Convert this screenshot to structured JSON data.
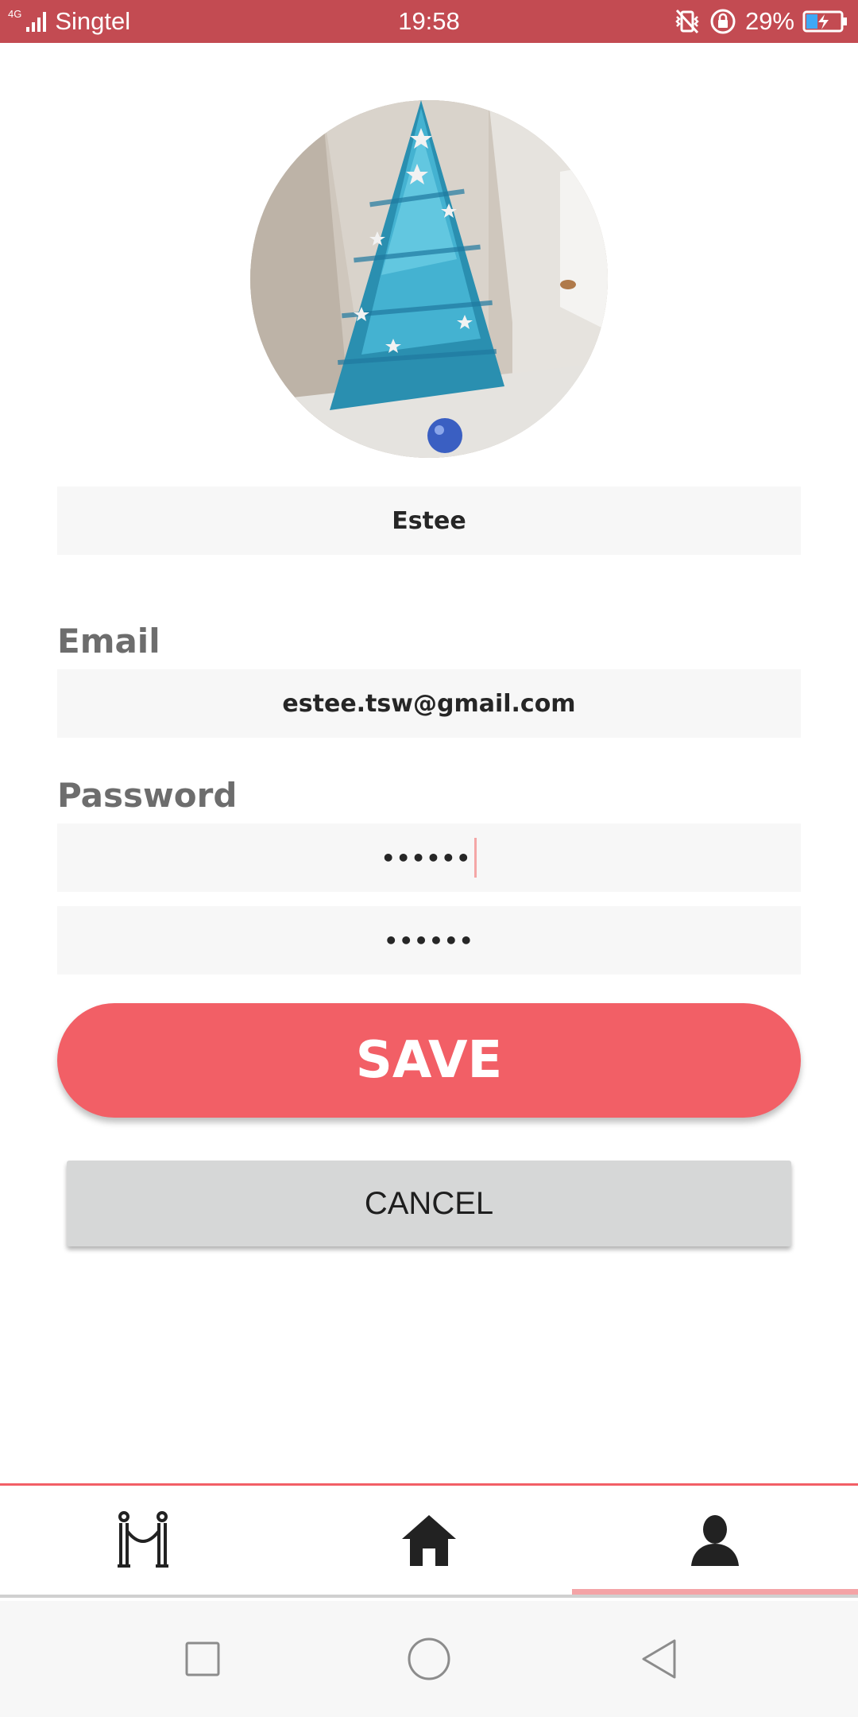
{
  "status_bar": {
    "network_type": "4G",
    "carrier": "Singtel",
    "time": "19:58",
    "battery_percent": "29%",
    "icons": [
      "signal-icon",
      "vibrate-icon",
      "rotation-lock-icon",
      "battery-charging-icon"
    ]
  },
  "profile": {
    "avatar": "christmas-tree-photo",
    "name_value": "Estee"
  },
  "email": {
    "label": "Email",
    "value": "estee.tsw@gmail.com"
  },
  "password": {
    "label": "Password",
    "value": "••••••",
    "confirm_value": "••••••"
  },
  "actions": {
    "save_label": "SAVE",
    "cancel_label": "CANCEL"
  },
  "bottom_nav": {
    "items": [
      {
        "icon": "rope-barrier-icon"
      },
      {
        "icon": "home-icon"
      },
      {
        "icon": "person-icon",
        "active": true
      }
    ]
  },
  "system_nav": {
    "icons": [
      "recents-square-icon",
      "home-circle-icon",
      "back-triangle-icon"
    ]
  },
  "colors": {
    "status_bar": "#c34b52",
    "accent": "#f25f66",
    "field_bg": "#f7f7f7",
    "cancel_bg": "#d6d7d7"
  }
}
